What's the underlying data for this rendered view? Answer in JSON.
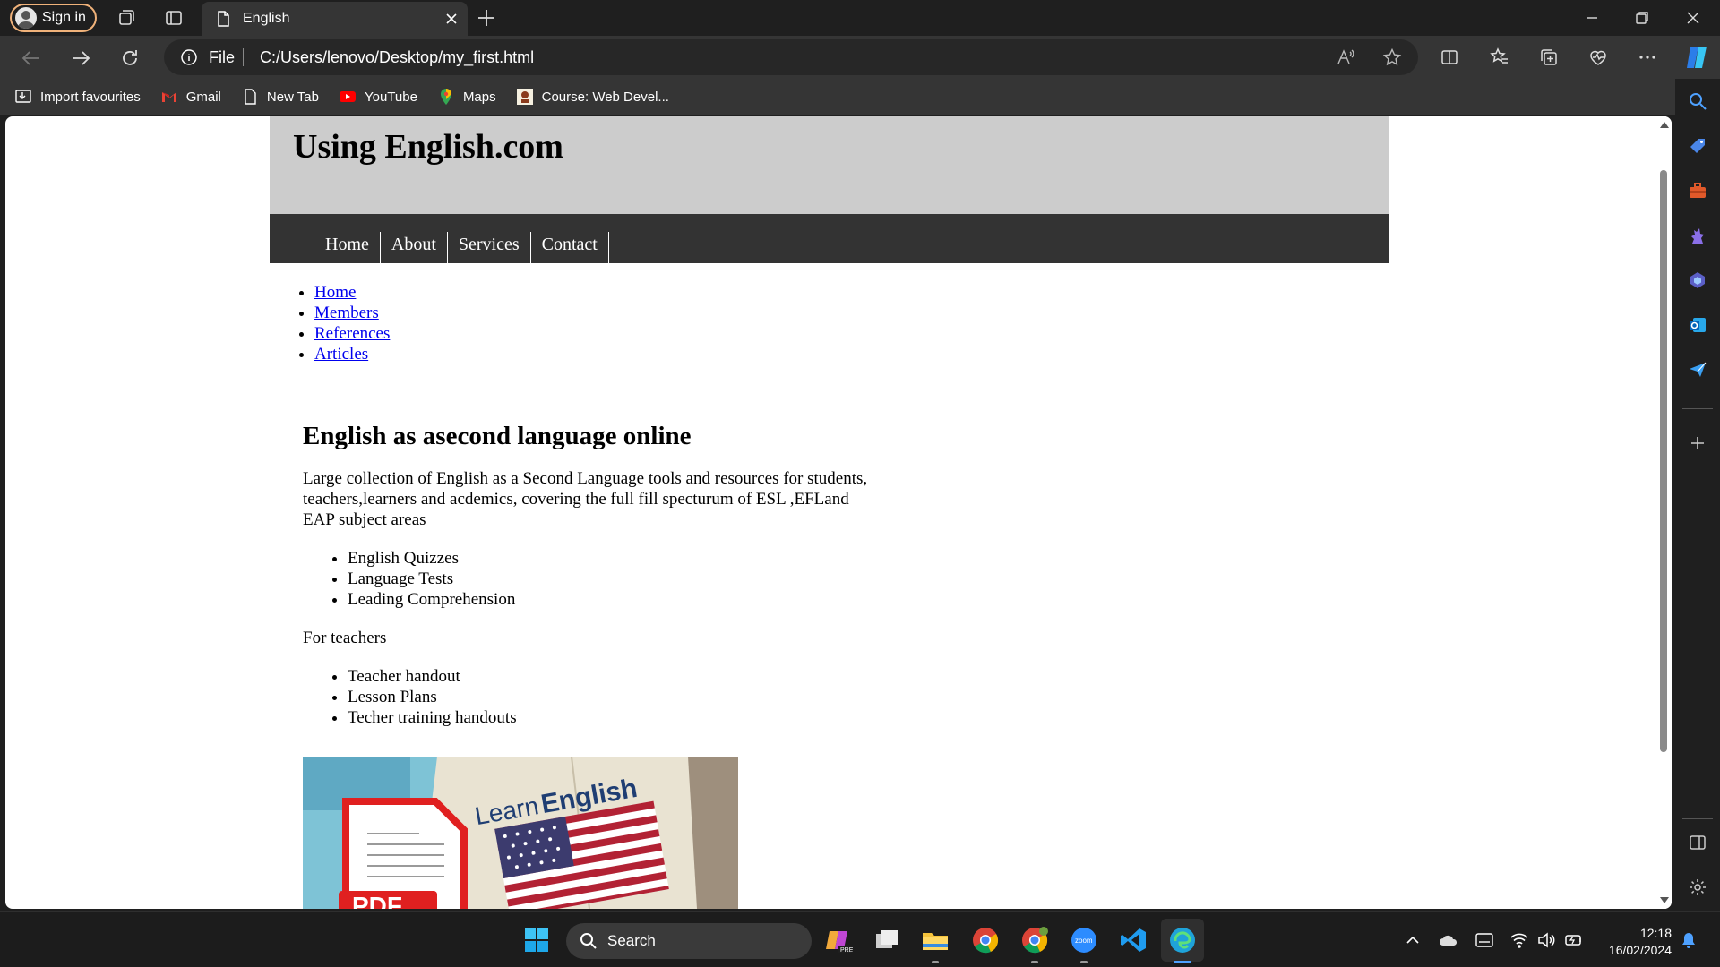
{
  "browser": {
    "signin_label": "Sign in",
    "tab_title": "English",
    "file_label": "File",
    "url": "C:/Users/lenovo/Desktop/my_first.html"
  },
  "bookmarks": [
    {
      "label": "Import favourites",
      "icon": "import-icon"
    },
    {
      "label": "Gmail",
      "icon": "gmail-icon"
    },
    {
      "label": "New Tab",
      "icon": "page-icon"
    },
    {
      "label": "YouTube",
      "icon": "youtube-icon"
    },
    {
      "label": "Maps",
      "icon": "maps-icon"
    },
    {
      "label": "Course: Web Devel...",
      "icon": "course-icon"
    }
  ],
  "page": {
    "site_title": "Using English.com",
    "menu": [
      "Home",
      "About",
      "Services",
      "Contact"
    ],
    "links": [
      "Home",
      "Members",
      "References",
      "Articles"
    ],
    "heading": "English as asecond language online",
    "intro": "Large collection of English as a Second Language tools and resources for students, teachers,learners and acdemics, covering the full fill specturum of ESL ,EFLand EAP subject areas",
    "students_list": [
      "English Quizzes",
      "Language Tests",
      "Leading Comprehension"
    ],
    "teachers_label": "For teachers",
    "teachers_list": [
      "Teacher handout",
      "Lesson Plans",
      "Techer training handouts"
    ],
    "image_text": {
      "learn": "Learn",
      "english": "English",
      "pdf": "PDF"
    }
  },
  "taskbar": {
    "search_label": "Search",
    "time": "12:18",
    "date": "16/02/2024"
  },
  "colors": {
    "header_bg": "#cccccc",
    "menubar_bg": "#333333",
    "link": "#0000ee",
    "browser_chrome": "#1f1f1f",
    "toolbar": "#353535"
  }
}
